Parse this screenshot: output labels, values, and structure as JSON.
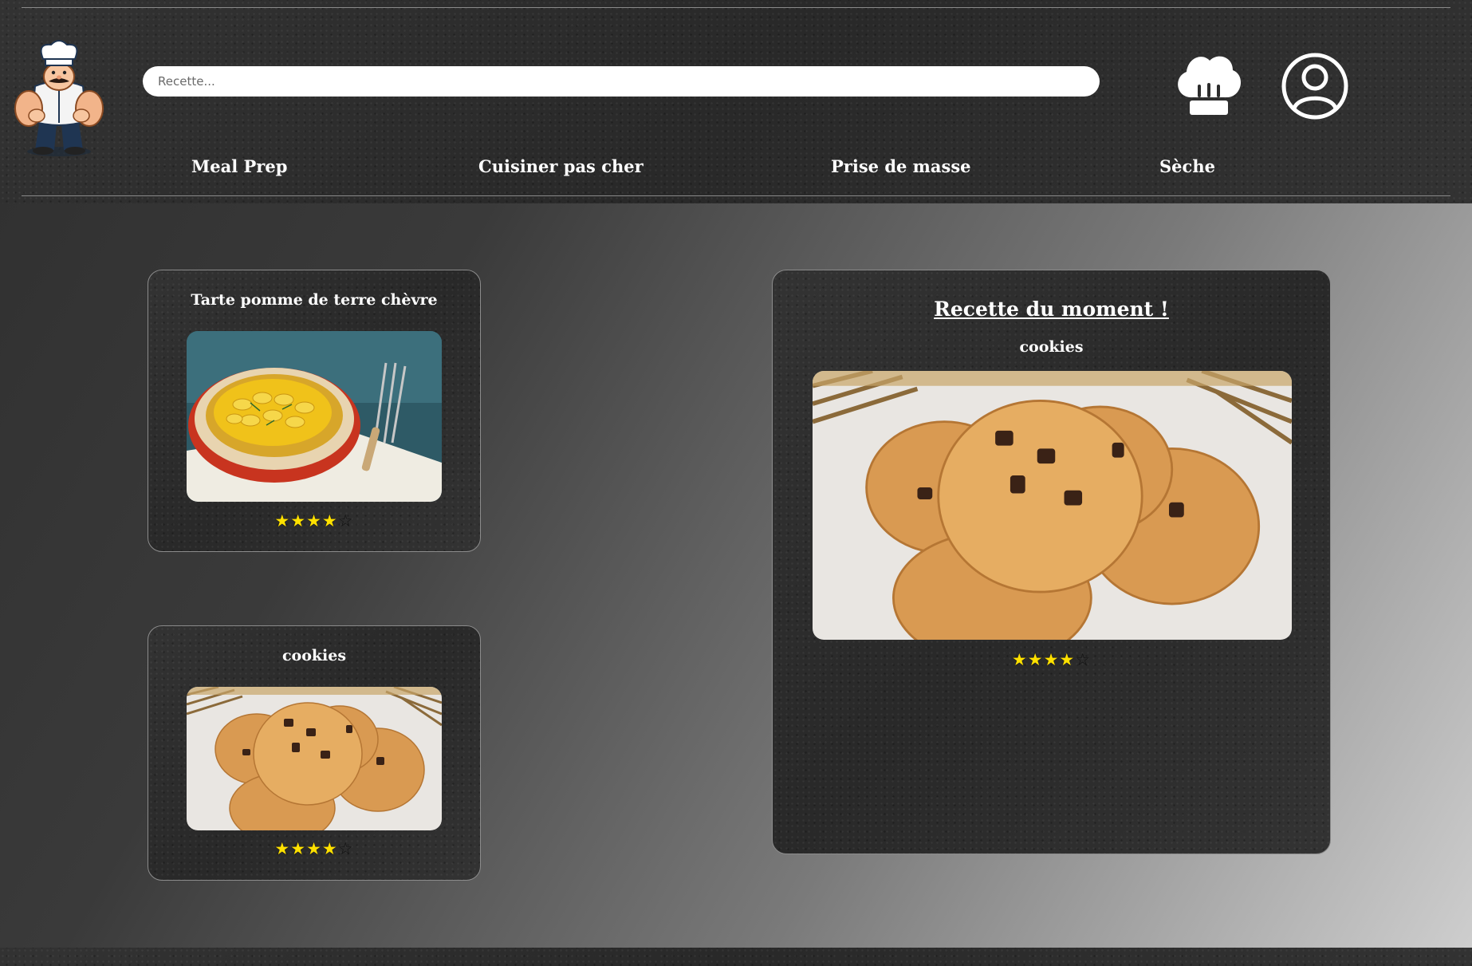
{
  "header": {
    "search_placeholder": "Recette...",
    "nav": [
      "Meal Prep",
      "Cuisiner pas cher",
      "Prise de masse",
      "Sèche"
    ]
  },
  "recipes": [
    {
      "title": "Tarte pomme de terre chèvre",
      "rating": 4,
      "rating_max": 5
    },
    {
      "title": "cookies",
      "rating": 4,
      "rating_max": 5
    }
  ],
  "featured": {
    "heading": "Recette du moment !",
    "title": "cookies",
    "rating": 4,
    "rating_max": 5
  },
  "icons": {
    "logo": "chef-mascot-logo",
    "chef_hat": "chef-hat-icon",
    "user": "user-circle-icon"
  }
}
